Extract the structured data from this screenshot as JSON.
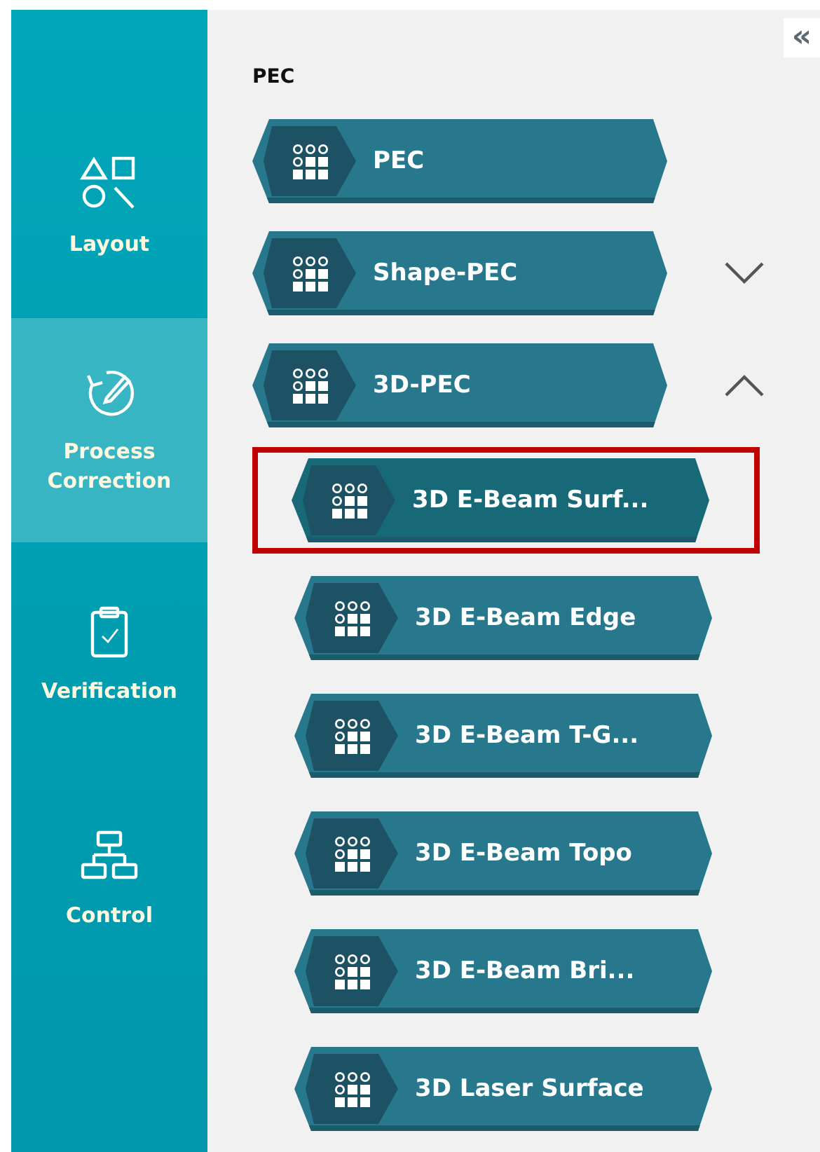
{
  "sidebar": {
    "items": [
      {
        "label": "Layout",
        "selected": false
      },
      {
        "label": "Process Correction",
        "selected": true
      },
      {
        "label": "Verification",
        "selected": false
      },
      {
        "label": "Control",
        "selected": false
      }
    ]
  },
  "collapse_button": {
    "label": "«"
  },
  "section": {
    "title": "PEC",
    "items": [
      {
        "label": "PEC",
        "selected": false
      },
      {
        "label": "Shape-PEC",
        "expanded": false,
        "selected": false
      },
      {
        "label": "3D-PEC",
        "expanded": true,
        "selected": false,
        "children": [
          {
            "label": "3D E-Beam Surf...",
            "selected": true
          },
          {
            "label": "3D E-Beam Edge",
            "selected": false
          },
          {
            "label": "3D E-Beam T-G...",
            "selected": false
          },
          {
            "label": "3D E-Beam Topo",
            "selected": false
          },
          {
            "label": "3D E-Beam Bri...",
            "selected": false
          },
          {
            "label": "3D Laser Surface",
            "selected": false
          }
        ]
      }
    ]
  }
}
